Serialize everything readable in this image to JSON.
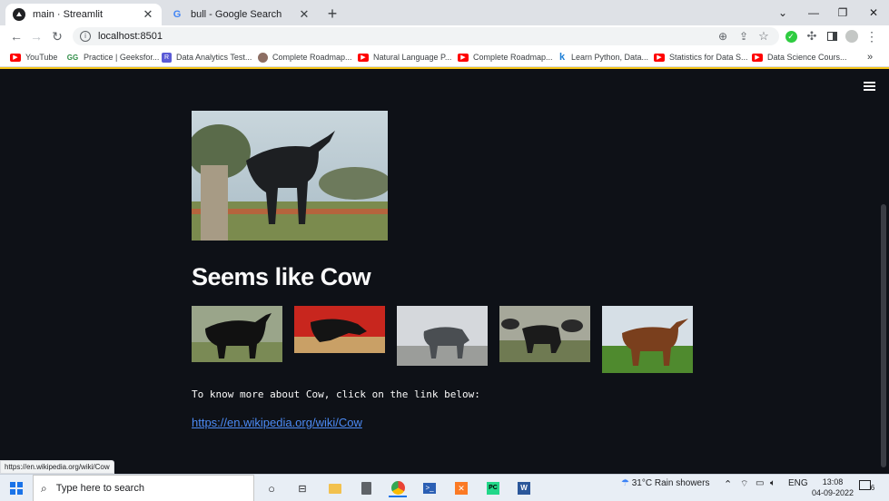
{
  "browser": {
    "tabs": [
      {
        "title": "main · Streamlit",
        "active": true,
        "icon": "streamlit-icon"
      },
      {
        "title": "bull - Google Search",
        "active": false,
        "icon": "google-icon"
      }
    ],
    "url": "localhost:8501",
    "bookmarks": [
      {
        "label": "YouTube",
        "icon": "youtube-icon"
      },
      {
        "label": "Practice | Geeksfor...",
        "icon": "geeksforgeeks-icon"
      },
      {
        "label": "Data Analytics Test...",
        "icon": "r-icon"
      },
      {
        "label": "Complete Roadmap...",
        "icon": "avatar-icon"
      },
      {
        "label": "Natural Language P...",
        "icon": "youtube-icon"
      },
      {
        "label": "Complete Roadmap...",
        "icon": "youtube-icon"
      },
      {
        "label": "Learn Python, Data...",
        "icon": "k-icon"
      },
      {
        "label": "Statistics for Data S...",
        "icon": "youtube-icon"
      },
      {
        "label": "Data Science Cours...",
        "icon": "youtube-icon"
      }
    ],
    "more_bookmarks": "»",
    "status_url": "https://en.wikipedia.org/wiki/Cow"
  },
  "page": {
    "heading": "Seems like Cow",
    "body_text": "To know more about Cow, click on the link below:",
    "link_text": "https://en.wikipedia.org/wiki/Cow",
    "thumbnails": 5
  },
  "taskbar": {
    "search_placeholder": "Type here to search",
    "weather": "31°C  Rain showers",
    "language": "ENG",
    "time": "13:08",
    "date": "04-09-2022",
    "notifications": "6"
  },
  "colors": {
    "background": "#0e1117",
    "text": "#fafafa",
    "link": "#4c8bf5",
    "tab_strip": "#dee1e6"
  }
}
